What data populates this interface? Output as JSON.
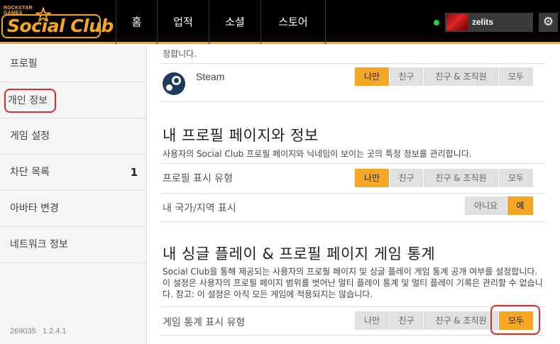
{
  "header": {
    "brand_small": "ROCKSTAR\nGAMES",
    "brand_name": "Social Club",
    "nav": [
      "홈",
      "업적",
      "소셜",
      "스토어"
    ],
    "username": "zelits"
  },
  "sidebar": {
    "items": [
      {
        "label": "프로필"
      },
      {
        "label": "개인 정보"
      },
      {
        "label": "게임 설정"
      },
      {
        "label": "차단 목록",
        "count": "1"
      },
      {
        "label": "아바타 변경"
      },
      {
        "label": "네트워크 정보"
      }
    ],
    "version_left": "269035",
    "version_right": "1.2.4.1"
  },
  "main": {
    "clipped_text": "정합니다.",
    "steam": {
      "label": "Steam",
      "options": [
        "나만",
        "친구",
        "친구 & 조직원",
        "모두"
      ],
      "selected": 0
    },
    "profile_section": {
      "title": "내 프로필 페이지와 정보",
      "desc": "사용자의 Social Club 프로필 페이지와 닉네임이 보이는 곳의 특정 정보를 관리합니다.",
      "rows": [
        {
          "label": "프로필 표시 유형",
          "options": [
            "나만",
            "친구",
            "친구 & 조직원",
            "모두"
          ],
          "selected": 0
        },
        {
          "label": "내 국가/지역 표시",
          "options": [
            "아니요",
            "예"
          ],
          "selected": 1
        }
      ]
    },
    "stats_section": {
      "title": "내 싱글 플레이 & 프로필 페이지 게임 통계",
      "desc": "Social Club을 통해 제공되는 사용자의 프로필 페이지 및 싱글 플레이 게임 통계 공개 여부를 설정합니다. 이 설정은 사용자의 프로필 페이지 범위를 벗어난 멀티 플레이 통계 및 멀티 플레이 기록은 관리할 수 없습니다. 참고: 이 설정은 아직 모든 게임에 적용되지는 않습니다.",
      "row": {
        "label": "게임 통계 표시 유형",
        "options": [
          "나만",
          "친구",
          "친구 & 조직원",
          "모두"
        ],
        "selected": 3
      }
    }
  },
  "colors": {
    "accent": "#f5a623",
    "highlight_ring": "#d42e2e",
    "online": "#2ecc40"
  }
}
